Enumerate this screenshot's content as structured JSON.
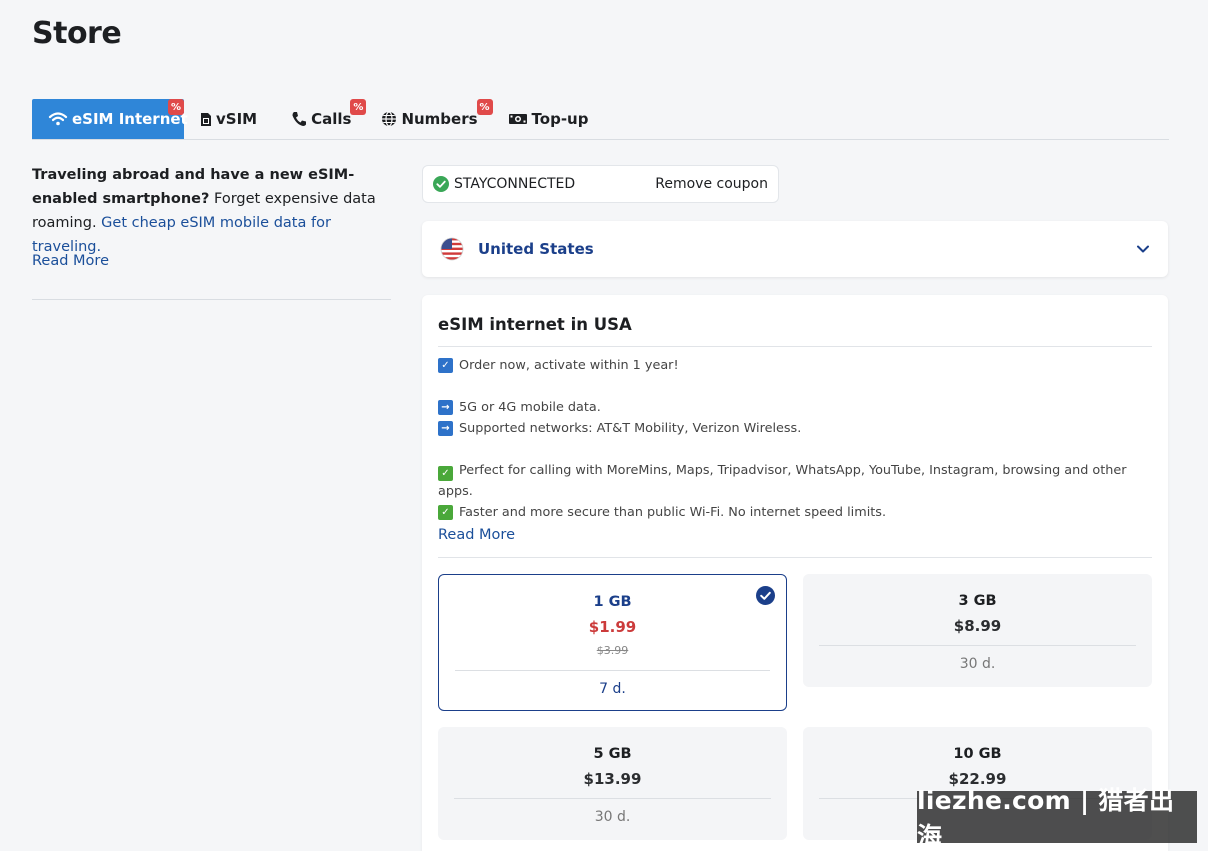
{
  "page": {
    "title": "Store"
  },
  "tabs": [
    {
      "label": "eSIM Internet",
      "icon": "wifi-icon",
      "badge": "%"
    },
    {
      "label": "vSIM",
      "icon": "sim-icon",
      "badge": ""
    },
    {
      "label": "Calls",
      "icon": "phone-icon",
      "badge": "%"
    },
    {
      "label": "Numbers",
      "icon": "globe-icon",
      "badge": "%"
    },
    {
      "label": "Top-up",
      "icon": "money-icon",
      "badge": ""
    }
  ],
  "intro": {
    "bold": "Traveling abroad and have a new eSIM-enabled smartphone?",
    "text": " Forget expensive data roaming. ",
    "link": "Get cheap eSIM mobile data for traveling.",
    "read_more": "Read More"
  },
  "coupon": {
    "code": "STAYCONNECTED",
    "remove_label": "Remove coupon"
  },
  "country": {
    "name": "United States"
  },
  "product": {
    "title": "eSIM internet in USA",
    "features": [
      {
        "icon": "checkbox-icon",
        "text": "Order now, activate within 1 year!"
      },
      {
        "icon": "arrow-right-icon",
        "text": "5G or 4G mobile data."
      },
      {
        "icon": "arrow-right-icon",
        "text": "Supported networks: AT&T Mobility, Verizon Wireless."
      },
      {
        "icon": "check-mark-icon",
        "text": "Perfect for calling with MoreMins, Maps, Tripadvisor, WhatsApp, YouTube, Instagram, browsing and other apps."
      },
      {
        "icon": "check-mark-icon",
        "text": "Faster and more secure than public Wi-Fi. No internet speed limits."
      }
    ],
    "read_more": "Read More",
    "plans": [
      {
        "data": "1 GB",
        "price": "$1.99",
        "old_price": "$3.99",
        "validity": "7 d.",
        "selected": true
      },
      {
        "data": "3 GB",
        "price": "$8.99",
        "old_price": "",
        "validity": "30 d.",
        "selected": false
      },
      {
        "data": "5 GB",
        "price": "$13.99",
        "old_price": "",
        "validity": "30 d.",
        "selected": false
      },
      {
        "data": "10 GB",
        "price": "$22.99",
        "old_price": "",
        "validity": "",
        "selected": false
      }
    ]
  },
  "watermark": "liezhe.com | 猎者出海",
  "colors": {
    "accent": "#2f86d8",
    "navy": "#1b3f8a",
    "sale_red": "#cc3b3b",
    "badge_red": "#e04a4a"
  }
}
